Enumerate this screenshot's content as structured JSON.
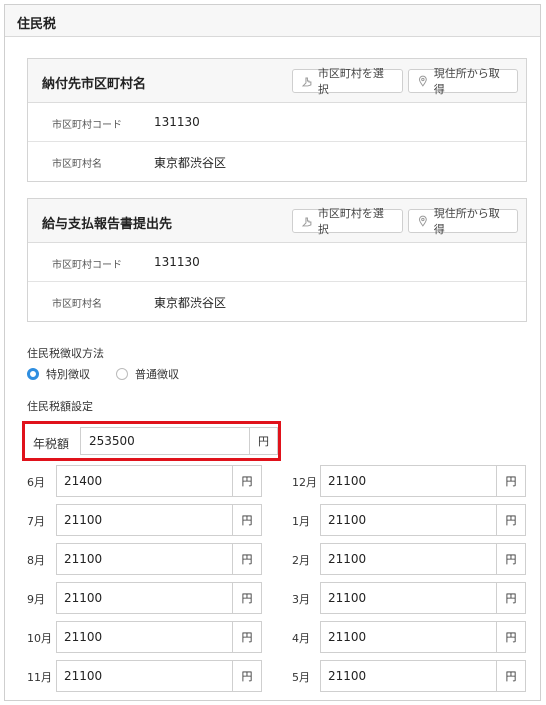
{
  "section_title": "住民税",
  "payment_municipality": {
    "title": "納付先市区町村名",
    "select_button": "市区町村を選択",
    "current_location_button": "現住所から取得",
    "rows": [
      {
        "label": "市区町村コード",
        "value": "131130"
      },
      {
        "label": "市区町村名",
        "value": "東京都渋谷区"
      }
    ]
  },
  "report_municipality": {
    "title": "給与支払報告書提出先",
    "select_button": "市区町村を選択",
    "current_location_button": "現住所から取得",
    "rows": [
      {
        "label": "市区町村コード",
        "value": "131130"
      },
      {
        "label": "市区町村名",
        "value": "東京都渋谷区"
      }
    ]
  },
  "collection_method": {
    "label": "住民税徴収方法",
    "options": [
      {
        "label": "特別徴収",
        "checked": true
      },
      {
        "label": "普通徴収",
        "checked": false
      }
    ]
  },
  "amount_setting": {
    "label": "住民税額設定",
    "annual_label": "年税額",
    "annual_value": "253500",
    "unit": "円"
  },
  "monthly": {
    "unit": "円",
    "left": [
      {
        "month": "6月",
        "value": "21400"
      },
      {
        "month": "7月",
        "value": "21100"
      },
      {
        "month": "8月",
        "value": "21100"
      },
      {
        "month": "9月",
        "value": "21100"
      },
      {
        "month": "10月",
        "value": "21100"
      },
      {
        "month": "11月",
        "value": "21100"
      }
    ],
    "right": [
      {
        "month": "12月",
        "value": "21100"
      },
      {
        "month": "1月",
        "value": "21100"
      },
      {
        "month": "2月",
        "value": "21100"
      },
      {
        "month": "3月",
        "value": "21100"
      },
      {
        "month": "4月",
        "value": "21100"
      },
      {
        "month": "5月",
        "value": "21100"
      }
    ]
  },
  "icons": {
    "select": "hand-pointer-icon",
    "location": "map-pin-icon"
  },
  "colors": {
    "radio_checked": "#2f8ee0",
    "highlight_border": "#e0121b"
  }
}
